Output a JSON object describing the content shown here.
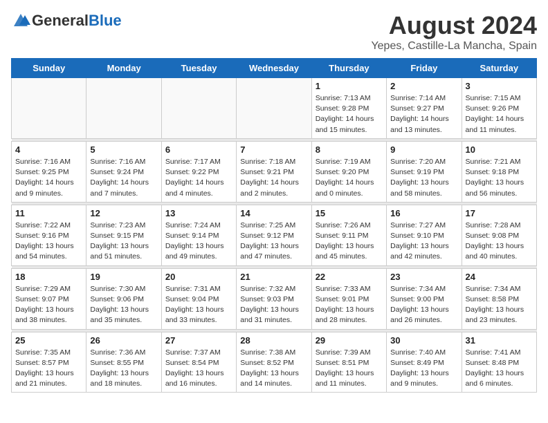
{
  "header": {
    "logo_general": "General",
    "logo_blue": "Blue",
    "month_title": "August 2024",
    "location": "Yepes, Castille-La Mancha, Spain"
  },
  "days_of_week": [
    "Sunday",
    "Monday",
    "Tuesday",
    "Wednesday",
    "Thursday",
    "Friday",
    "Saturday"
  ],
  "weeks": [
    {
      "days": [
        {
          "day": "",
          "info": ""
        },
        {
          "day": "",
          "info": ""
        },
        {
          "day": "",
          "info": ""
        },
        {
          "day": "",
          "info": ""
        },
        {
          "day": "1",
          "info": "Sunrise: 7:13 AM\nSunset: 9:28 PM\nDaylight: 14 hours\nand 15 minutes."
        },
        {
          "day": "2",
          "info": "Sunrise: 7:14 AM\nSunset: 9:27 PM\nDaylight: 14 hours\nand 13 minutes."
        },
        {
          "day": "3",
          "info": "Sunrise: 7:15 AM\nSunset: 9:26 PM\nDaylight: 14 hours\nand 11 minutes."
        }
      ]
    },
    {
      "days": [
        {
          "day": "4",
          "info": "Sunrise: 7:16 AM\nSunset: 9:25 PM\nDaylight: 14 hours\nand 9 minutes."
        },
        {
          "day": "5",
          "info": "Sunrise: 7:16 AM\nSunset: 9:24 PM\nDaylight: 14 hours\nand 7 minutes."
        },
        {
          "day": "6",
          "info": "Sunrise: 7:17 AM\nSunset: 9:22 PM\nDaylight: 14 hours\nand 4 minutes."
        },
        {
          "day": "7",
          "info": "Sunrise: 7:18 AM\nSunset: 9:21 PM\nDaylight: 14 hours\nand 2 minutes."
        },
        {
          "day": "8",
          "info": "Sunrise: 7:19 AM\nSunset: 9:20 PM\nDaylight: 14 hours\nand 0 minutes."
        },
        {
          "day": "9",
          "info": "Sunrise: 7:20 AM\nSunset: 9:19 PM\nDaylight: 13 hours\nand 58 minutes."
        },
        {
          "day": "10",
          "info": "Sunrise: 7:21 AM\nSunset: 9:18 PM\nDaylight: 13 hours\nand 56 minutes."
        }
      ]
    },
    {
      "days": [
        {
          "day": "11",
          "info": "Sunrise: 7:22 AM\nSunset: 9:16 PM\nDaylight: 13 hours\nand 54 minutes."
        },
        {
          "day": "12",
          "info": "Sunrise: 7:23 AM\nSunset: 9:15 PM\nDaylight: 13 hours\nand 51 minutes."
        },
        {
          "day": "13",
          "info": "Sunrise: 7:24 AM\nSunset: 9:14 PM\nDaylight: 13 hours\nand 49 minutes."
        },
        {
          "day": "14",
          "info": "Sunrise: 7:25 AM\nSunset: 9:12 PM\nDaylight: 13 hours\nand 47 minutes."
        },
        {
          "day": "15",
          "info": "Sunrise: 7:26 AM\nSunset: 9:11 PM\nDaylight: 13 hours\nand 45 minutes."
        },
        {
          "day": "16",
          "info": "Sunrise: 7:27 AM\nSunset: 9:10 PM\nDaylight: 13 hours\nand 42 minutes."
        },
        {
          "day": "17",
          "info": "Sunrise: 7:28 AM\nSunset: 9:08 PM\nDaylight: 13 hours\nand 40 minutes."
        }
      ]
    },
    {
      "days": [
        {
          "day": "18",
          "info": "Sunrise: 7:29 AM\nSunset: 9:07 PM\nDaylight: 13 hours\nand 38 minutes."
        },
        {
          "day": "19",
          "info": "Sunrise: 7:30 AM\nSunset: 9:06 PM\nDaylight: 13 hours\nand 35 minutes."
        },
        {
          "day": "20",
          "info": "Sunrise: 7:31 AM\nSunset: 9:04 PM\nDaylight: 13 hours\nand 33 minutes."
        },
        {
          "day": "21",
          "info": "Sunrise: 7:32 AM\nSunset: 9:03 PM\nDaylight: 13 hours\nand 31 minutes."
        },
        {
          "day": "22",
          "info": "Sunrise: 7:33 AM\nSunset: 9:01 PM\nDaylight: 13 hours\nand 28 minutes."
        },
        {
          "day": "23",
          "info": "Sunrise: 7:34 AM\nSunset: 9:00 PM\nDaylight: 13 hours\nand 26 minutes."
        },
        {
          "day": "24",
          "info": "Sunrise: 7:34 AM\nSunset: 8:58 PM\nDaylight: 13 hours\nand 23 minutes."
        }
      ]
    },
    {
      "days": [
        {
          "day": "25",
          "info": "Sunrise: 7:35 AM\nSunset: 8:57 PM\nDaylight: 13 hours\nand 21 minutes."
        },
        {
          "day": "26",
          "info": "Sunrise: 7:36 AM\nSunset: 8:55 PM\nDaylight: 13 hours\nand 18 minutes."
        },
        {
          "day": "27",
          "info": "Sunrise: 7:37 AM\nSunset: 8:54 PM\nDaylight: 13 hours\nand 16 minutes."
        },
        {
          "day": "28",
          "info": "Sunrise: 7:38 AM\nSunset: 8:52 PM\nDaylight: 13 hours\nand 14 minutes."
        },
        {
          "day": "29",
          "info": "Sunrise: 7:39 AM\nSunset: 8:51 PM\nDaylight: 13 hours\nand 11 minutes."
        },
        {
          "day": "30",
          "info": "Sunrise: 7:40 AM\nSunset: 8:49 PM\nDaylight: 13 hours\nand 9 minutes."
        },
        {
          "day": "31",
          "info": "Sunrise: 7:41 AM\nSunset: 8:48 PM\nDaylight: 13 hours\nand 6 minutes."
        }
      ]
    }
  ]
}
